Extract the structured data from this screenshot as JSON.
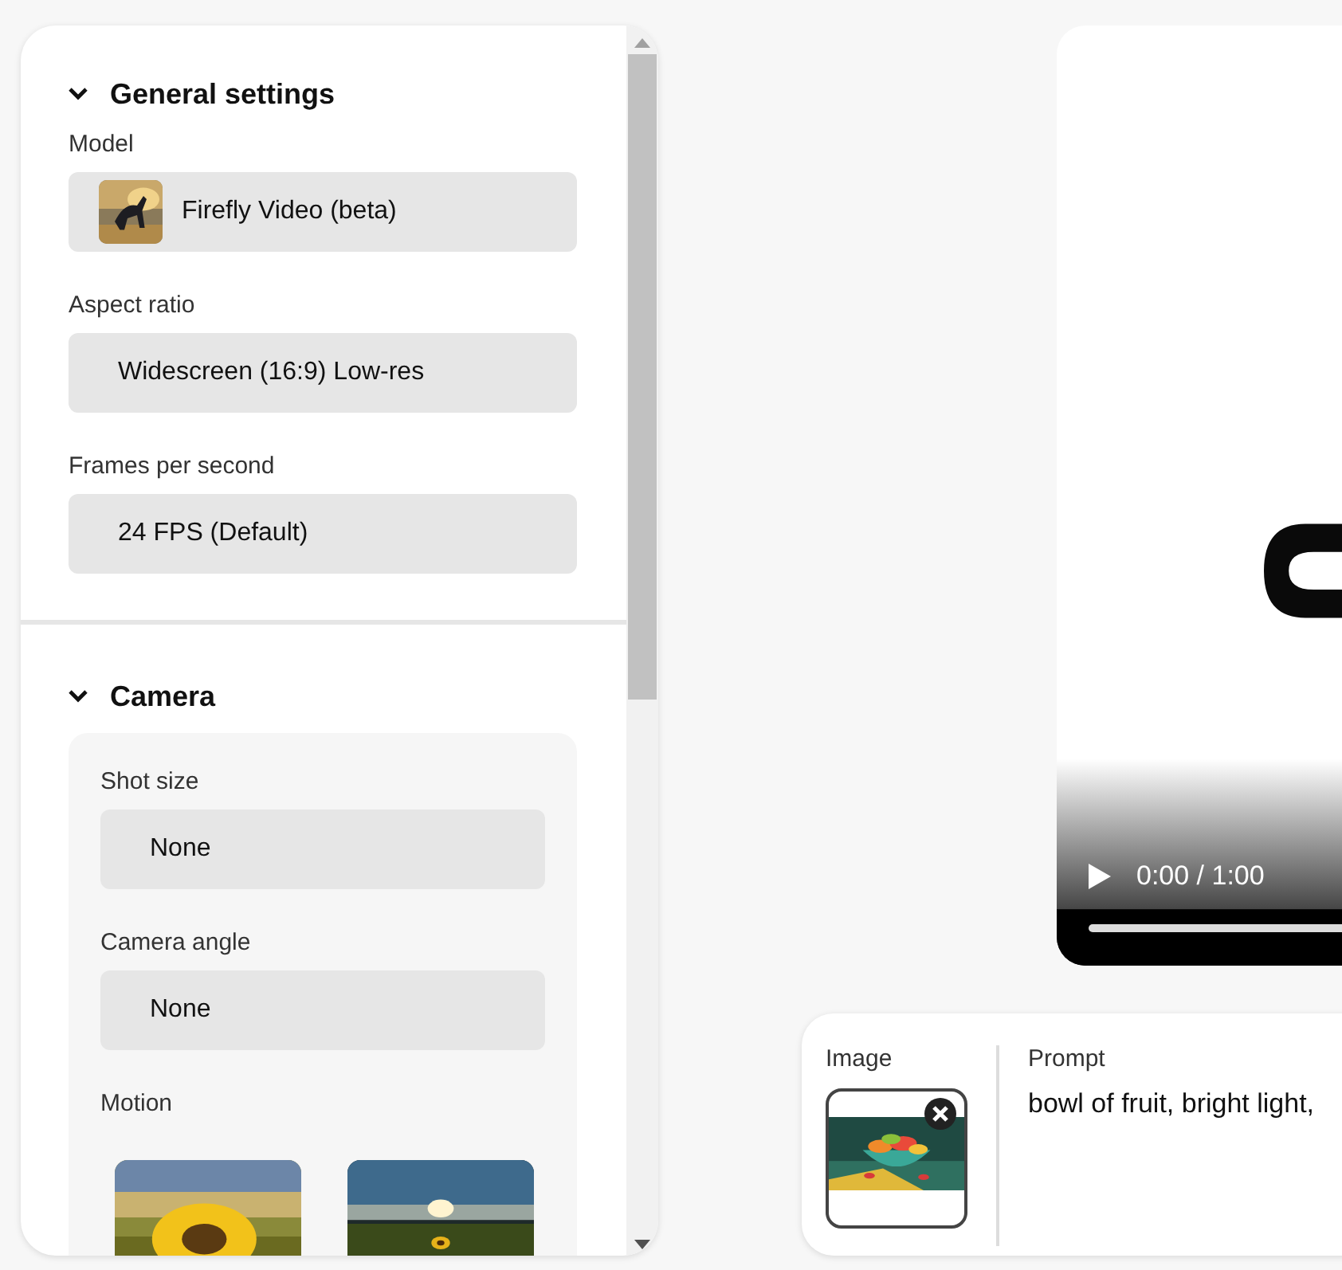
{
  "panel": {
    "sections": [
      {
        "title": "General settings",
        "expanded": true,
        "kind": "plain",
        "fields": [
          {
            "kind": "model-select",
            "label": "Model",
            "value": "Firefly Video (beta)"
          },
          {
            "kind": "select",
            "label": "Aspect ratio",
            "value": "Widescreen (16:9) Low-res"
          },
          {
            "kind": "select",
            "label": "Frames per second",
            "value": "24 FPS (Default)"
          }
        ]
      },
      {
        "title": "Camera",
        "expanded": true,
        "kind": "card",
        "fields": [
          {
            "kind": "select",
            "label": "Shot size",
            "value": "None"
          },
          {
            "kind": "select",
            "label": "Camera angle",
            "value": "None"
          },
          {
            "kind": "presets",
            "label": "Motion"
          }
        ]
      }
    ]
  },
  "video": {
    "playing": false,
    "time": "0:00 / 1:00"
  },
  "prompt_bar": {
    "image_label": "Image",
    "prompt_label": "Prompt",
    "prompt": "bowl of fruit, bright light,"
  }
}
